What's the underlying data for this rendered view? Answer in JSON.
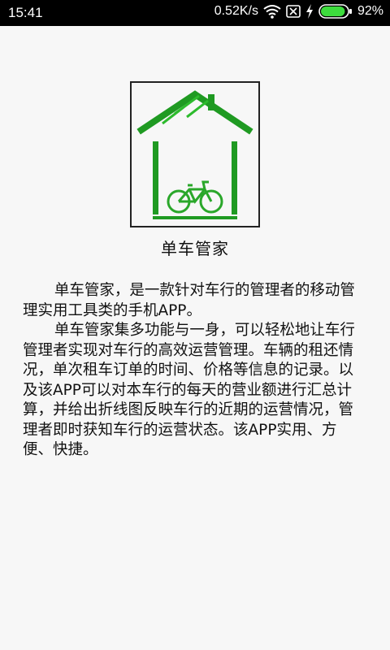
{
  "status_bar": {
    "time": "15:41",
    "net_speed": "0.52K/s",
    "battery_percent": "92%",
    "battery_level": 0.92,
    "icons": [
      "wifi-icon",
      "no-sim-icon",
      "charging-icon",
      "battery-icon"
    ]
  },
  "app": {
    "name": "单车管家",
    "brand_color": "#1f9a22"
  },
  "description": {
    "paragraphs": [
      "单车管家，是一款针对车行的管理者的移动管理实用工具类的手机APP。",
      "单车管家集多功能与一身，可以轻松地让车行管理者实现对车行的高效运营管理。车辆的租还情况，单次租车订单的时间、价格等信息的记录。以及该APP可以对本车行的每天的营业额进行汇总计算，并给出折线图反映车行的近期的运营情况，管理者即时获知车行的运营状态。该APP实用、方便、快捷。"
    ]
  }
}
